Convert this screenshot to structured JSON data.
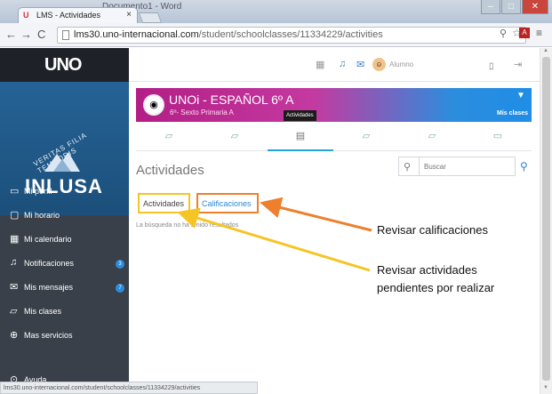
{
  "window": {
    "doc_title": "Documento1 - Word"
  },
  "browser": {
    "tab_title": "LMS - Actividades",
    "tab_close": "×",
    "url_host": "lms30.uno-internacional.com",
    "url_path": "/student/schoolclasses/11334229/activities",
    "status_url": "lms30.uno-internacional.com/student/schoolclasses/11334229/activities"
  },
  "app": {
    "logo": "UNO",
    "school_name": "INLUSA",
    "seal_text": "VERITAS FILIA TEMPORIS",
    "user_label": "Alumno"
  },
  "sidebar": {
    "items": [
      {
        "label": "Mi perfil",
        "icon": "id-card-icon"
      },
      {
        "label": "Mi horario",
        "icon": "monitor-icon"
      },
      {
        "label": "Mi calendario",
        "icon": "calendar-icon"
      },
      {
        "label": "Notificaciones",
        "icon": "bell-icon",
        "badge": "3"
      },
      {
        "label": "Mis mensajes",
        "icon": "mail-icon",
        "badge": "7"
      },
      {
        "label": "Mis clases",
        "icon": "chat-icon"
      },
      {
        "label": "Mas servicios",
        "icon": "plus-circle-icon"
      }
    ],
    "bottom_partial": "Ayuda"
  },
  "course": {
    "title": "UNOi - ESPAÑOL 6º A",
    "subtitle": "6º- Sexto Primaria A",
    "tooltip": "Actividades",
    "mis_clases": "Mis clases"
  },
  "page": {
    "heading": "Actividades",
    "search_placeholder": "Buscar",
    "tab_activities": "Actividades",
    "tab_grades": "Calificaciones",
    "no_results": "La búsqueda no ha tenido resultados"
  },
  "annotations": {
    "grades": "Revisar calificaciones",
    "activities_line1": "Revisar actividades",
    "activities_line2": "pendientes por realizar"
  },
  "colors": {
    "sidebar": "#3a4049",
    "accent_blue": "#26a3d9",
    "annotation_orange": "#ee7f2d",
    "annotation_yellow": "#f6c424"
  }
}
